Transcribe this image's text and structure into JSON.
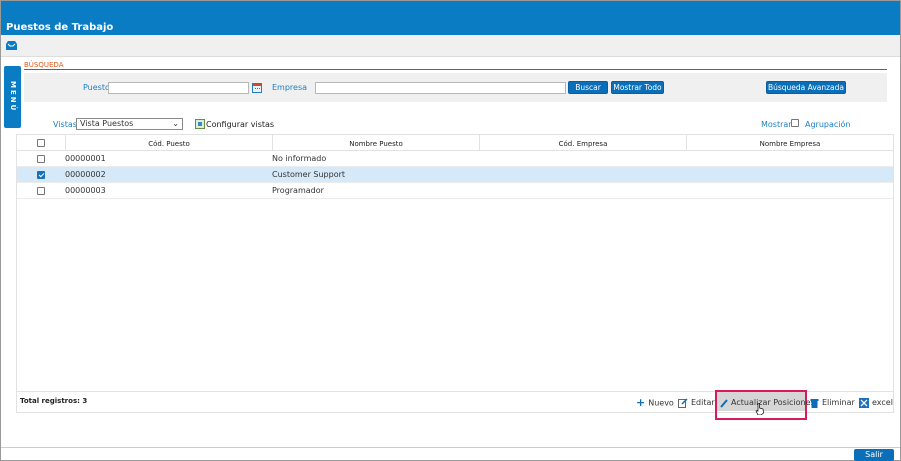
{
  "window": {
    "title": "Puestos de Trabajo"
  },
  "sidebar": {
    "menu_label": "MENÚ"
  },
  "search": {
    "section_label": "BÚSQUEDA",
    "puesto_label": "Puesto",
    "puesto_value": "",
    "empresa_label": "Empresa",
    "empresa_value": "",
    "buscar_label": "Buscar",
    "mostrar_todo_label": "Mostrar Todo",
    "avanzada_label": "Búsqueda Avanzada"
  },
  "views": {
    "label": "Vistas",
    "selected": "Vista Puestos",
    "configure_label": "Configurar vistas",
    "mostrar_label": "Mostrar:",
    "agrupacion_label": "Agrupación"
  },
  "table": {
    "columns": [
      "Cód. Puesto",
      "Nombre Puesto",
      "Cód. Empresa",
      "Nombre Empresa"
    ],
    "rows": [
      {
        "cod": "00000001",
        "nombre": "No informado",
        "cod_empresa": "",
        "nombre_empresa": "",
        "checked": false
      },
      {
        "cod": "00000002",
        "nombre": "Customer Support",
        "cod_empresa": "",
        "nombre_empresa": "",
        "checked": true
      },
      {
        "cod": "00000003",
        "nombre": "Programador",
        "cod_empresa": "",
        "nombre_empresa": "",
        "checked": false
      }
    ]
  },
  "footer": {
    "total_label": "Total registros: 3",
    "nuevo": "Nuevo",
    "editar": "Editar",
    "actualizar": "Actualizar Posiciones",
    "eliminar": "Eliminar",
    "excel": "excel"
  },
  "bottom": {
    "salir": "Salir"
  },
  "colors": {
    "primary": "#0a7cc4",
    "accent_orange": "#e05a1c",
    "highlight": "#d81b5a",
    "selected_row": "#d6e9f8"
  }
}
